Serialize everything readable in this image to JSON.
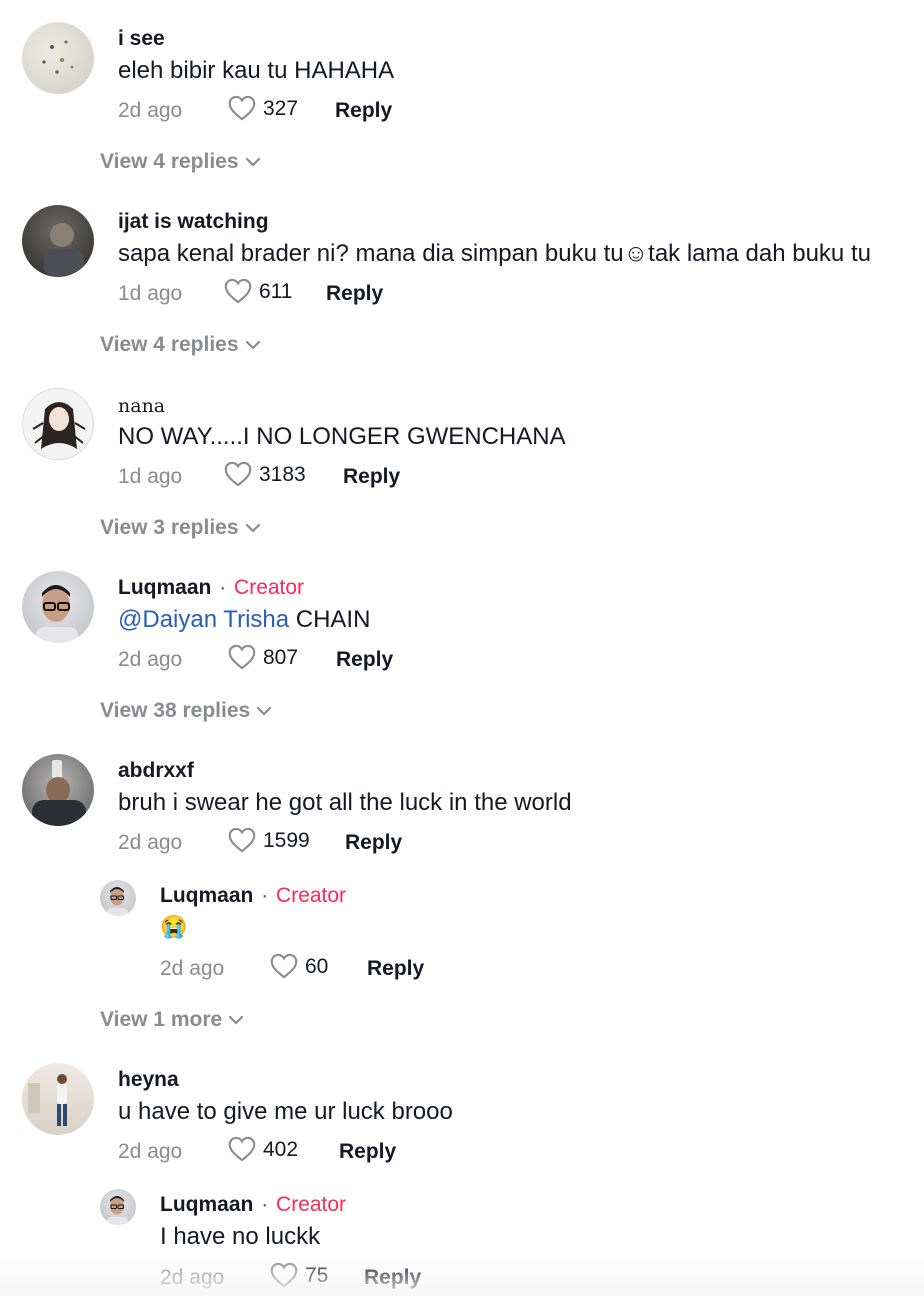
{
  "labels": {
    "reply": "Reply",
    "creator": "Creator",
    "dot": "·"
  },
  "colors": {
    "creator": "#fe2c55",
    "mention": "#2b5db9",
    "muted": "#8a8b91"
  },
  "comments": [
    {
      "username": "i see",
      "text": "eleh bibir kau tu HAHAHA",
      "time": "2d ago",
      "likes": "327",
      "view_more": "View 4 replies"
    },
    {
      "username": "ijat is watching",
      "text": "sapa kenal brader ni? mana dia simpan buku tu☺︎tak lama dah buku tu",
      "time": "1d ago",
      "likes": "611",
      "view_more": "View 4 replies"
    },
    {
      "username": "nana",
      "text": "NO WAY.....I NO LONGER GWENCHANA",
      "time": "1d ago",
      "likes": "3183",
      "view_more": "View 3 replies"
    },
    {
      "username": "Luqmaan",
      "mention": "@Daiyan Trisha",
      "text": " CHAIN",
      "time": "2d ago",
      "likes": "807",
      "view_more": "View 38 replies"
    },
    {
      "username": "abdrxxf",
      "text": "bruh i swear he got all the luck in the world",
      "time": "2d ago",
      "likes": "1599",
      "reply": {
        "username": "Luqmaan",
        "text": "😭",
        "time": "2d ago",
        "likes": "60"
      },
      "view_more": "View 1 more"
    },
    {
      "username": "heyna",
      "text": "u have to give me ur luck brooo",
      "time": "2d ago",
      "likes": "402",
      "reply": {
        "username": "Luqmaan",
        "text": "I have no luckk",
        "time": "2d ago",
        "likes": "75"
      }
    }
  ]
}
